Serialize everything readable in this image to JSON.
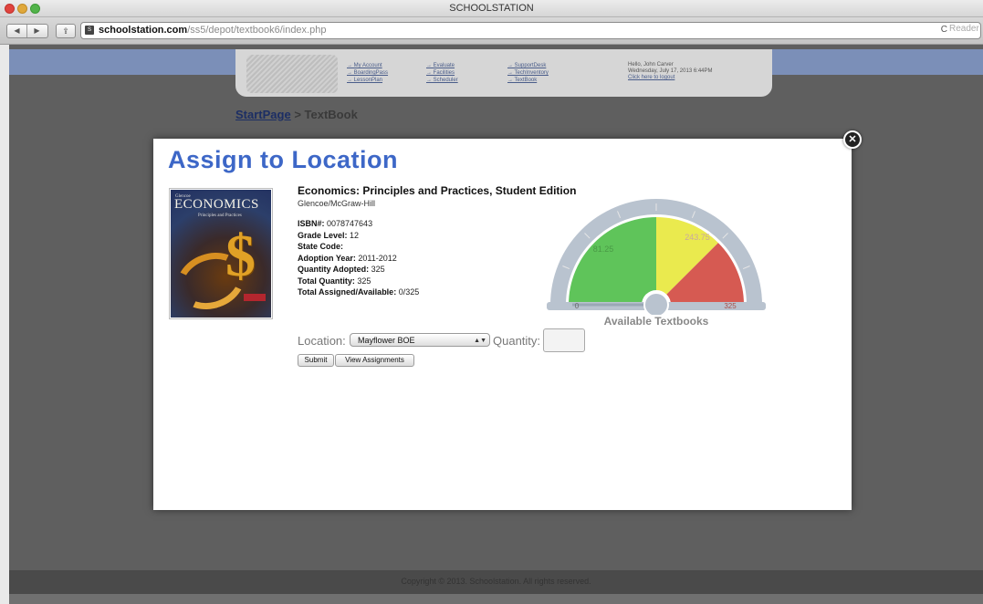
{
  "window": {
    "title": "SCHOOLSTATION"
  },
  "browser": {
    "url_host": "schoolstation.com",
    "url_path": "/ss5/depot/textbook6/index.php",
    "reader_label": "Reader",
    "back_glyph": "◀",
    "forward_glyph": "▶",
    "reload_glyph": "C",
    "share_icon": "share-icon",
    "favicon_text": "S"
  },
  "nav": {
    "col1": [
      "→ My Account",
      "→ BoardingPass",
      "→ LessonPlan"
    ],
    "col2": [
      "→ Evaluate",
      "→ Facilities",
      "→ Scheduler"
    ],
    "col3": [
      "→ SupportDesk",
      "→ TechInventory",
      "→ TextBook"
    ],
    "greeting": "Hello, John Carver",
    "date": "Wednesday, July 17, 2013 6:44PM",
    "logout": "Click here to logout"
  },
  "breadcrumb": {
    "link": "StartPage",
    "separator": " > ",
    "current": "TextBook"
  },
  "modal": {
    "title": "Assign to Location",
    "close_glyph": "✕",
    "cover": {
      "publisher": "Glencoe",
      "title": "ECONOMICS",
      "subtitle": "Principles and Practices",
      "symbol": "$"
    },
    "book": {
      "title": "Economics: Principles and Practices, Student Edition",
      "publisher": "Glencoe/McGraw-Hill",
      "fields": [
        {
          "label": "ISBN#:",
          "value": " 0078747643"
        },
        {
          "label": "Grade Level:",
          "value": " 12"
        },
        {
          "label": "State Code:",
          "value": ""
        },
        {
          "label": "Adoption Year:",
          "value": " 2011-2012"
        },
        {
          "label": "Quantity Adopted:",
          "value": " 325"
        },
        {
          "label": "Total Quantity:",
          "value": " 325"
        },
        {
          "label": "Total Assigned/Available:",
          "value": " 0/325"
        }
      ]
    },
    "location_label": "Location:",
    "location_value": "Mayflower BOE",
    "quantity_label": "Quantity:",
    "quantity_value": "",
    "submit_label": "Submit",
    "view_label": "View Assignments",
    "gauge": {
      "caption": "Available Textbooks",
      "min_label": "0",
      "max_label": "325",
      "mid_label": "243.75",
      "low_label": "81.25",
      "value": 0,
      "max": 325,
      "colors": {
        "green": "#5fc45a",
        "yellow": "#eaea4e",
        "red": "#d65a52",
        "frame": "#b9c3cf"
      }
    }
  },
  "footer": {
    "text": "Copyright © 2013. Schoolstation. All rights reserved."
  }
}
